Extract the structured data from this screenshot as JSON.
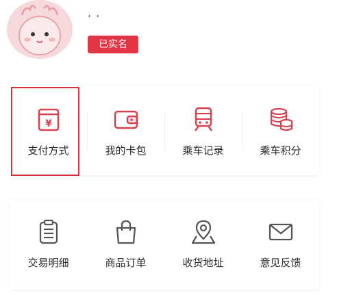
{
  "profile": {
    "name_text": "· ·",
    "verified_label": "已实名"
  },
  "services": [
    {
      "label": "支付方式",
      "icon": "wallet-card-icon"
    },
    {
      "label": "我的卡包",
      "icon": "card-wallet-icon"
    },
    {
      "label": "乘车记录",
      "icon": "train-icon"
    },
    {
      "label": "乘车积分",
      "icon": "coins-icon"
    }
  ],
  "account": [
    {
      "label": "交易明细",
      "icon": "clipboard-icon"
    },
    {
      "label": "商品订单",
      "icon": "shopping-bag-icon"
    },
    {
      "label": "收货地址",
      "icon": "location-pin-icon"
    },
    {
      "label": "意见反馈",
      "icon": "envelope-icon"
    }
  ],
  "colors": {
    "accent": "#e23545",
    "icon_red": "#d9404e",
    "icon_gray": "#555555",
    "highlight_border": "#d8323f"
  }
}
